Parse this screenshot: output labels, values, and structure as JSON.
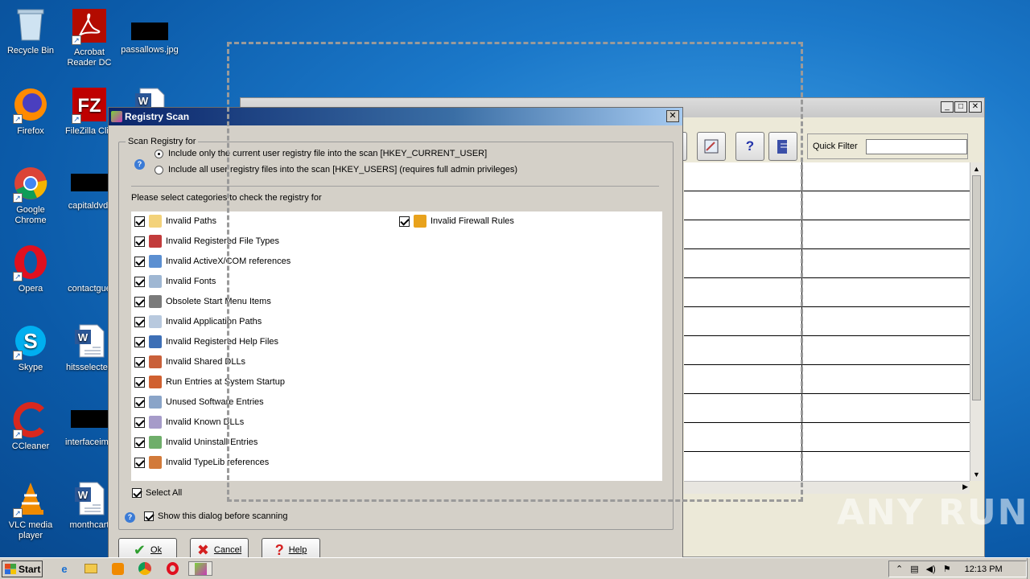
{
  "desktop": {
    "icons": [
      {
        "label": "Recycle Bin",
        "icon": "recycle-bin-icon"
      },
      {
        "label": "Acrobat Reader DC",
        "icon": "acrobat-icon"
      },
      {
        "label": "passallows.jpg",
        "icon": "image-file-icon"
      },
      {
        "label": "Firefox",
        "icon": "firefox-icon"
      },
      {
        "label": "FileZilla Clie",
        "icon": "filezilla-icon"
      },
      {
        "label": "Google Chrome",
        "icon": "chrome-icon"
      },
      {
        "label": "capitaldvd.",
        "icon": "file-icon"
      },
      {
        "label": "Opera",
        "icon": "opera-icon"
      },
      {
        "label": "contactgue",
        "icon": "file-icon"
      },
      {
        "label": "Skype",
        "icon": "skype-icon"
      },
      {
        "label": "hitsselected",
        "icon": "word-doc-icon"
      },
      {
        "label": "CCleaner",
        "icon": "ccleaner-icon"
      },
      {
        "label": "interfaceima",
        "icon": "file-icon"
      },
      {
        "label": "VLC media player",
        "icon": "vlc-icon"
      },
      {
        "label": "monthcart",
        "icon": "word-doc-icon"
      }
    ]
  },
  "background_window": {
    "quick_filter_label": "Quick Filter",
    "quick_filter_value": ""
  },
  "dialog": {
    "title": "Registry Scan",
    "scan_group_label": "Scan Registry for",
    "option_current_user": "Include only the current user registry file into the scan [HKEY_CURRENT_USER]",
    "option_all_users": "Include all user registry files into the scan [HKEY_USERS] (requires full admin privileges)",
    "categories_prompt": "Please select categories to check the registry for",
    "categories": [
      "Invalid Paths",
      "Invalid Registered File Types",
      "Invalid ActiveX/COM references",
      "Invalid Fonts",
      "Obsolete Start Menu Items",
      "Invalid Application Paths",
      "Invalid Registered Help Files",
      "Invalid Shared DLLs",
      "Run Entries at System Startup",
      "Unused Software Entries",
      "Invalid Known DLLs",
      "Invalid Uninstall Entries",
      "Invalid TypeLib references"
    ],
    "category_right": "Invalid Firewall Rules",
    "select_all_label": "Select All",
    "show_dialog_label": "Show this dialog before scanning",
    "ok_label": "Ok",
    "cancel_label": "Cancel",
    "help_label": "Help"
  },
  "taskbar": {
    "start_label": "Start",
    "clock": "12:13 PM"
  },
  "watermark": "ANY RUN"
}
